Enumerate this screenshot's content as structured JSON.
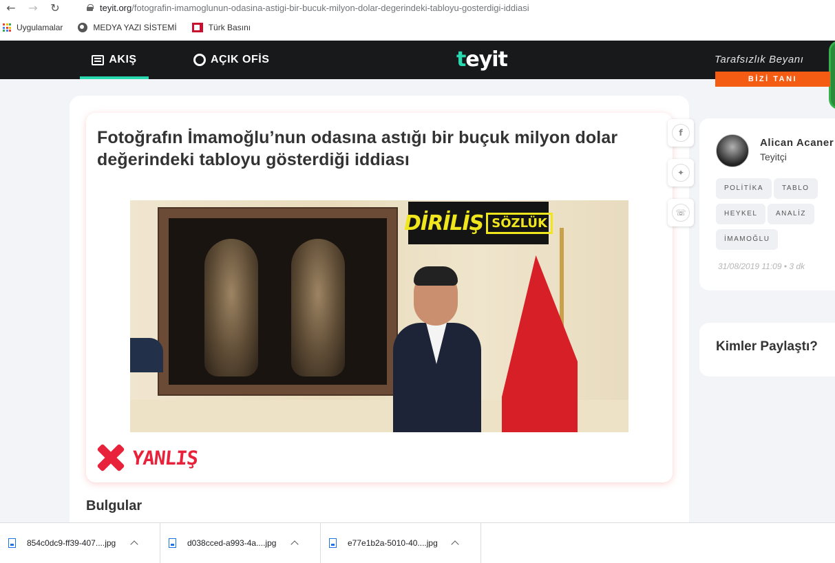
{
  "browser": {
    "url_host": "teyit.org",
    "url_path": "/fotografin-imamoglunun-odasina-astigi-bir-bucuk-milyon-dolar-degerindeki-tabloyu-gosterdigi-iddiasi",
    "bookmarks": [
      "Uygulamalar",
      "MEDYA YAZI SİSTEMİ",
      "Türk Basını"
    ]
  },
  "header": {
    "nav": [
      "AKIŞ",
      "AÇIK OFİS"
    ],
    "logo": "teyit",
    "logo_accent": "t",
    "logo_rest": "eyit",
    "impartiality": "Tarafsızlık Beyanı",
    "cta": "BİZİ TANI",
    "accent_color": "#28d9b0",
    "cta_color": "#f45b13"
  },
  "article": {
    "title": "Fotoğrafın İmamoğlu’nun odasına astığı bir buçuk milyon dolar değerindeki tabloyu gösterdiği iddiası",
    "image_watermark_1": "DİRİLİŞ",
    "image_watermark_2": "SÖZLÜK",
    "verdict": "YANLIŞ",
    "verdict_color": "#e8223a",
    "section_heading": "Bulgular",
    "share_icons": [
      "facebook-icon",
      "twitter-icon",
      "whatsapp-icon"
    ]
  },
  "author": {
    "name": "Alican Acaner",
    "role": "Teyitçi",
    "tags": [
      "POLİTİKA",
      "TABLO",
      "HEYKEL",
      "ANALİZ",
      "İMAMOĞLU"
    ],
    "date": "31/08/2019 11:09 • 3 dk"
  },
  "share_panel": {
    "title": "Kimler Paylaştı?"
  },
  "downloads": [
    {
      "name": "854c0dc9-ff39-407....jpg"
    },
    {
      "name": "d038cced-a993-4a....jpg"
    },
    {
      "name": "e77e1b2a-5010-40....jpg"
    }
  ]
}
